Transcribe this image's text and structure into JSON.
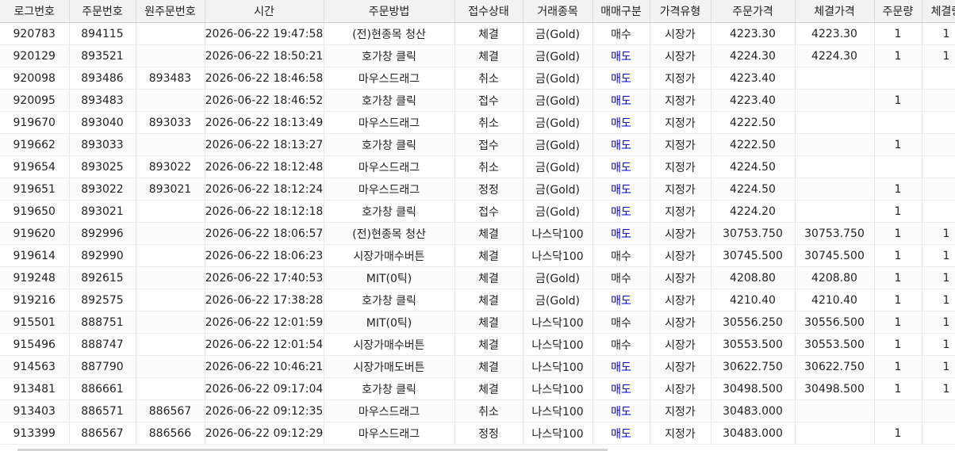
{
  "columns": [
    {
      "key": "log_no",
      "label": "로그번호"
    },
    {
      "key": "order_no",
      "label": "주문번호"
    },
    {
      "key": "orig_order_no",
      "label": "원주문번호"
    },
    {
      "key": "time",
      "label": "시간"
    },
    {
      "key": "method",
      "label": "주문방법"
    },
    {
      "key": "status",
      "label": "접수상태"
    },
    {
      "key": "symbol",
      "label": "거래종목"
    },
    {
      "key": "side",
      "label": "매매구분"
    },
    {
      "key": "price_type",
      "label": "가격유형"
    },
    {
      "key": "order_price",
      "label": "주문가격"
    },
    {
      "key": "fill_price",
      "label": "체결가격"
    },
    {
      "key": "order_qty",
      "label": "주문량"
    },
    {
      "key": "fill_qty",
      "label": "체결량"
    }
  ],
  "side_colors": {
    "buy": "#222222",
    "sell": "#0000cc"
  },
  "rows": [
    {
      "log_no": "920783",
      "order_no": "894115",
      "orig_order_no": "",
      "time": "2026-06-22 19:47:58",
      "method": "(전)현종목 청산",
      "status": "체결",
      "symbol": "금(Gold)",
      "side": "매수",
      "price_type": "시장가",
      "order_price": "4223.30",
      "fill_price": "4223.30",
      "order_qty": "1",
      "fill_qty": "1"
    },
    {
      "log_no": "920129",
      "order_no": "893521",
      "orig_order_no": "",
      "time": "2026-06-22 18:50:21",
      "method": "호가창 클릭",
      "status": "체결",
      "symbol": "금(Gold)",
      "side": "매도",
      "price_type": "시장가",
      "order_price": "4224.30",
      "fill_price": "4224.30",
      "order_qty": "1",
      "fill_qty": "1"
    },
    {
      "log_no": "920098",
      "order_no": "893486",
      "orig_order_no": "893483",
      "time": "2026-06-22 18:46:58",
      "method": "마우스드래그",
      "status": "취소",
      "symbol": "금(Gold)",
      "side": "매도",
      "price_type": "지정가",
      "order_price": "4223.40",
      "fill_price": "",
      "order_qty": "",
      "fill_qty": ""
    },
    {
      "log_no": "920095",
      "order_no": "893483",
      "orig_order_no": "",
      "time": "2026-06-22 18:46:52",
      "method": "호가창 클릭",
      "status": "접수",
      "symbol": "금(Gold)",
      "side": "매도",
      "price_type": "지정가",
      "order_price": "4223.40",
      "fill_price": "",
      "order_qty": "1",
      "fill_qty": ""
    },
    {
      "log_no": "919670",
      "order_no": "893040",
      "orig_order_no": "893033",
      "time": "2026-06-22 18:13:49",
      "method": "마우스드래그",
      "status": "취소",
      "symbol": "금(Gold)",
      "side": "매도",
      "price_type": "지정가",
      "order_price": "4222.50",
      "fill_price": "",
      "order_qty": "",
      "fill_qty": ""
    },
    {
      "log_no": "919662",
      "order_no": "893033",
      "orig_order_no": "",
      "time": "2026-06-22 18:13:27",
      "method": "호가창 클릭",
      "status": "접수",
      "symbol": "금(Gold)",
      "side": "매도",
      "price_type": "지정가",
      "order_price": "4222.50",
      "fill_price": "",
      "order_qty": "1",
      "fill_qty": ""
    },
    {
      "log_no": "919654",
      "order_no": "893025",
      "orig_order_no": "893022",
      "time": "2026-06-22 18:12:48",
      "method": "마우스드래그",
      "status": "취소",
      "symbol": "금(Gold)",
      "side": "매도",
      "price_type": "지정가",
      "order_price": "4224.50",
      "fill_price": "",
      "order_qty": "",
      "fill_qty": ""
    },
    {
      "log_no": "919651",
      "order_no": "893022",
      "orig_order_no": "893021",
      "time": "2026-06-22 18:12:24",
      "method": "마우스드래그",
      "status": "정정",
      "symbol": "금(Gold)",
      "side": "매도",
      "price_type": "지정가",
      "order_price": "4224.50",
      "fill_price": "",
      "order_qty": "1",
      "fill_qty": ""
    },
    {
      "log_no": "919650",
      "order_no": "893021",
      "orig_order_no": "",
      "time": "2026-06-22 18:12:18",
      "method": "호가창 클릭",
      "status": "접수",
      "symbol": "금(Gold)",
      "side": "매도",
      "price_type": "지정가",
      "order_price": "4224.20",
      "fill_price": "",
      "order_qty": "1",
      "fill_qty": ""
    },
    {
      "log_no": "919620",
      "order_no": "892996",
      "orig_order_no": "",
      "time": "2026-06-22 18:06:57",
      "method": "(전)현종목 청산",
      "status": "체결",
      "symbol": "나스닥100",
      "side": "매도",
      "price_type": "시장가",
      "order_price": "30753.750",
      "fill_price": "30753.750",
      "order_qty": "1",
      "fill_qty": "1"
    },
    {
      "log_no": "919614",
      "order_no": "892990",
      "orig_order_no": "",
      "time": "2026-06-22 18:06:23",
      "method": "시장가매수버튼",
      "status": "체결",
      "symbol": "나스닥100",
      "side": "매수",
      "price_type": "시장가",
      "order_price": "30745.500",
      "fill_price": "30745.500",
      "order_qty": "1",
      "fill_qty": "1"
    },
    {
      "log_no": "919248",
      "order_no": "892615",
      "orig_order_no": "",
      "time": "2026-06-22 17:40:53",
      "method": "MIT(0틱)",
      "status": "체결",
      "symbol": "금(Gold)",
      "side": "매수",
      "price_type": "시장가",
      "order_price": "4208.80",
      "fill_price": "4208.80",
      "order_qty": "1",
      "fill_qty": "1"
    },
    {
      "log_no": "919216",
      "order_no": "892575",
      "orig_order_no": "",
      "time": "2026-06-22 17:38:28",
      "method": "호가창 클릭",
      "status": "체결",
      "symbol": "금(Gold)",
      "side": "매도",
      "price_type": "시장가",
      "order_price": "4210.40",
      "fill_price": "4210.40",
      "order_qty": "1",
      "fill_qty": "1"
    },
    {
      "log_no": "915501",
      "order_no": "888751",
      "orig_order_no": "",
      "time": "2026-06-22 12:01:59",
      "method": "MIT(0틱)",
      "status": "체결",
      "symbol": "나스닥100",
      "side": "매수",
      "price_type": "시장가",
      "order_price": "30556.250",
      "fill_price": "30556.500",
      "order_qty": "1",
      "fill_qty": "1"
    },
    {
      "log_no": "915496",
      "order_no": "888747",
      "orig_order_no": "",
      "time": "2026-06-22 12:01:54",
      "method": "시장가매수버튼",
      "status": "체결",
      "symbol": "나스닥100",
      "side": "매수",
      "price_type": "시장가",
      "order_price": "30553.500",
      "fill_price": "30553.500",
      "order_qty": "1",
      "fill_qty": "1"
    },
    {
      "log_no": "914563",
      "order_no": "887790",
      "orig_order_no": "",
      "time": "2026-06-22 10:46:21",
      "method": "시장가매도버튼",
      "status": "체결",
      "symbol": "나스닥100",
      "side": "매도",
      "price_type": "시장가",
      "order_price": "30622.750",
      "fill_price": "30622.750",
      "order_qty": "1",
      "fill_qty": "1"
    },
    {
      "log_no": "913481",
      "order_no": "886661",
      "orig_order_no": "",
      "time": "2026-06-22 09:17:04",
      "method": "호가창 클릭",
      "status": "체결",
      "symbol": "나스닥100",
      "side": "매도",
      "price_type": "시장가",
      "order_price": "30498.500",
      "fill_price": "30498.500",
      "order_qty": "1",
      "fill_qty": "1"
    },
    {
      "log_no": "913403",
      "order_no": "886571",
      "orig_order_no": "886567",
      "time": "2026-06-22 09:12:35",
      "method": "마우스드래그",
      "status": "취소",
      "symbol": "나스닥100",
      "side": "매도",
      "price_type": "지정가",
      "order_price": "30483.000",
      "fill_price": "",
      "order_qty": "",
      "fill_qty": ""
    },
    {
      "log_no": "913399",
      "order_no": "886567",
      "orig_order_no": "886566",
      "time": "2026-06-22 09:12:29",
      "method": "마우스드래그",
      "status": "정정",
      "symbol": "나스닥100",
      "side": "매도",
      "price_type": "지정가",
      "order_price": "30483.000",
      "fill_price": "",
      "order_qty": "1",
      "fill_qty": ""
    }
  ]
}
